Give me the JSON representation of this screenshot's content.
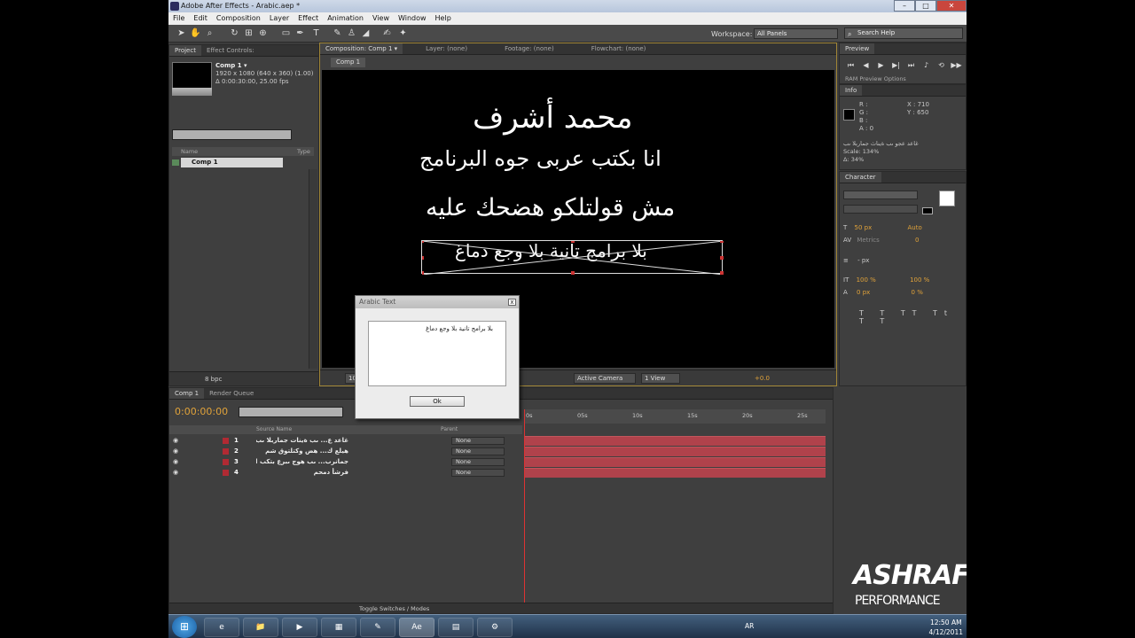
{
  "window": {
    "title": "Adobe After Effects - Arabic.aep *",
    "minimize": "–",
    "maximize": "□",
    "close": "✕"
  },
  "menu": [
    "File",
    "Edit",
    "Composition",
    "Layer",
    "Effect",
    "Animation",
    "View",
    "Window",
    "Help"
  ],
  "toolbar": {
    "workspace_label": "Workspace:",
    "workspace_value": "All Panels",
    "search_placeholder": "Search Help"
  },
  "project": {
    "tabs": [
      "Project",
      "Effect Controls: "
    ],
    "comp_name": "Comp 1 ▾",
    "comp_info": "1920 x 1080  (640 x 360) (1.00)",
    "comp_duration": "Δ 0:00:30:00, 25.00 fps",
    "col_name": "Name",
    "col_type": "Type",
    "item": "Comp 1",
    "bpc": "8 bpc"
  },
  "composition": {
    "tabs": [
      "Composition: Comp 1 ▾",
      "Layer: (none)",
      "Footage: (none)",
      "Flowchart: (none)"
    ],
    "subtab": "Comp 1",
    "lines": [
      "محمد أشرف",
      "انا بكتب عربى جوه البرنامج",
      "مش قولتلكو هضحك عليه",
      "بلا برامج تانية بلا وجع دماغ"
    ],
    "zoom": "100%",
    "camera": "Active Camera",
    "views": "1 View",
    "exposure": "+0.0"
  },
  "preview": {
    "tab": "Preview",
    "ram_options": "RAM Preview Options"
  },
  "info": {
    "tab": "Info",
    "r": "R :",
    "g": "G :",
    "b": "B :",
    "a": "A :  0",
    "x": "X : 710",
    "y": "Y : 650",
    "msg": "غاعد عجو ىب ةيناث جماربلا ىب",
    "scale": "Scale: 134%",
    "delta": "Δ: 34%"
  },
  "character": {
    "tab": "Character",
    "font_size": "50 px",
    "leading": "Auto",
    "kerning": "Metrics",
    "tracking": "0",
    "stroke": "- px",
    "vscale": "100 %",
    "hscale": "100 %",
    "baseline": "0 px",
    "tsume": "0 %"
  },
  "timeline": {
    "tabs": [
      "Comp 1",
      "Render Queue"
    ],
    "time": "0:00:00:00",
    "col_source": "Source Name",
    "col_parent": "Parent",
    "layers": [
      {
        "num": "1",
        "name": "غاعد ع... ىب ةينات جماربلا ىب",
        "parent": "None"
      },
      {
        "num": "2",
        "name": "هيلع ك... هض وكتلتوق شم",
        "parent": "None"
      },
      {
        "num": "3",
        "name": "جمانرب... ىب هوج ىبرع بتكب انا",
        "parent": "None"
      },
      {
        "num": "4",
        "name": "فرشأ دمحم",
        "parent": "None"
      }
    ],
    "ruler": [
      "0s",
      "05s",
      "10s",
      "15s",
      "20s",
      "25s"
    ],
    "toggle": "Toggle Switches / Modes"
  },
  "dialog": {
    "title": "Arabic Text",
    "text": "بلا برامج تانية بلا وجع دماغ",
    "ok": "Ok"
  },
  "taskbar": {
    "lang": "AR",
    "time": "12:50 AM",
    "date": "4/12/2011",
    "apps": [
      "e",
      "📁",
      "▶",
      "▦",
      "✎",
      "Ae",
      "▤",
      "⚙"
    ]
  },
  "watermark": {
    "line1": "ASHRAF",
    "line2": "PERFORMANCE"
  }
}
